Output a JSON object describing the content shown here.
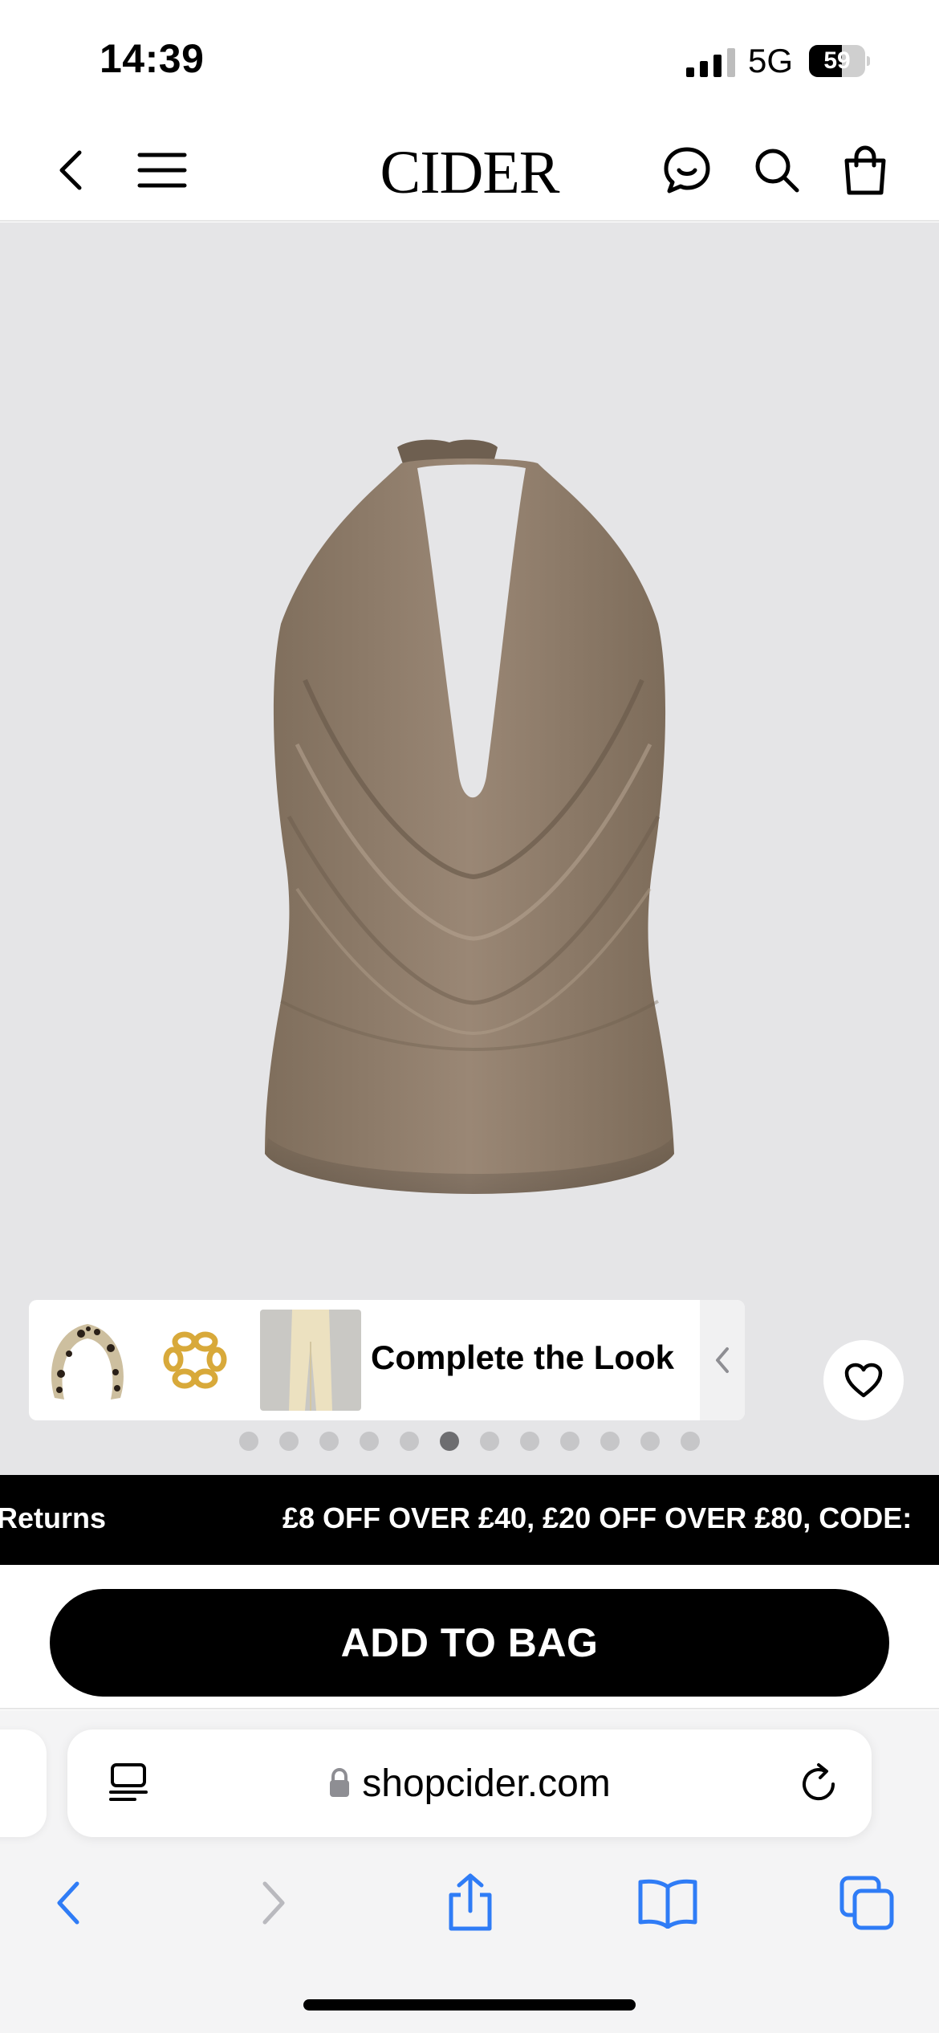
{
  "status_bar": {
    "time": "14:39",
    "network": "5G",
    "battery": "59",
    "battery_level": 0.59
  },
  "header": {
    "brand": "CIDER",
    "icons": [
      "back-icon",
      "menu-icon",
      "chat-icon",
      "search-icon",
      "shopping-bag-icon"
    ]
  },
  "gallery": {
    "complete_look": {
      "title": "Complete the Look",
      "thumbnails": [
        "leopard-headband",
        "gold-chain-bracelet",
        "cream-trousers"
      ]
    },
    "dots_total": 12,
    "active_dot": 6
  },
  "promo": {
    "left_text": "Returns",
    "main_text": "£8 OFF OVER £40, £20 OFF OVER £80, CODE:"
  },
  "actions": {
    "add_to_bag": "ADD TO BAG"
  },
  "browser": {
    "url": "shopcider.com",
    "toolbar": [
      "back-icon",
      "forward-icon",
      "share-icon",
      "bookmarks-icon",
      "tabs-icon"
    ]
  },
  "colors": {
    "gallery_bg": "#e5e5e7",
    "safari_blue": "#2f7cf6",
    "primary": "#000000"
  }
}
